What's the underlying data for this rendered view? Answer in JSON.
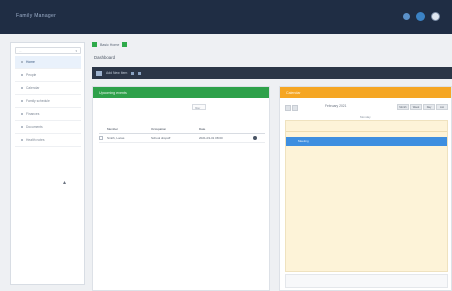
{
  "topbar": {
    "brand": "Family Manager"
  },
  "sidebar": {
    "search_placeholder": "...",
    "items": [
      {
        "label": "Home"
      },
      {
        "label": "People"
      },
      {
        "label": "Calendar"
      },
      {
        "label": "Family schedule"
      },
      {
        "label": "Finances"
      },
      {
        "label": "Documents"
      },
      {
        "label": "Health notes"
      }
    ]
  },
  "main": {
    "breadcrumb": "Basic Home",
    "page_title": "Dashboard",
    "toolbar_text": "Add New Item",
    "left_panel": {
      "header": "Upcoming events",
      "filter": "filter",
      "columns": [
        "Member",
        "Occupation",
        "Date"
      ],
      "rows": [
        {
          "member": "Smith, Lucas",
          "occupation": "School dropoff",
          "date": "2021-03-31 08:00"
        }
      ]
    },
    "right_panel": {
      "header": "Calendar",
      "title": "February 2021",
      "view_buttons": [
        "Month",
        "Week",
        "Day",
        "List"
      ],
      "day_label": "Monday",
      "event": "Meeting"
    }
  }
}
